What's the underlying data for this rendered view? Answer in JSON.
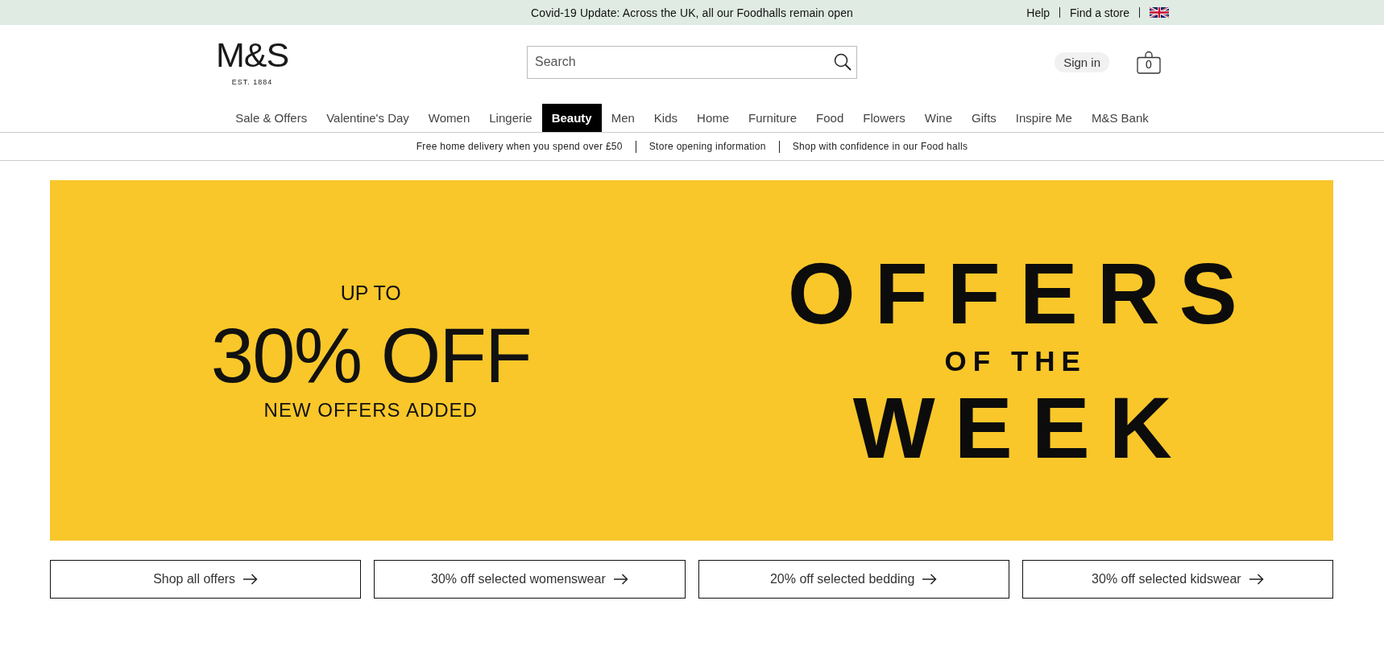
{
  "announcement_bar": {
    "message": "Covid-19 Update: Across the UK, all our Foodhalls remain open",
    "links": [
      "Help",
      "Find a store"
    ]
  },
  "header": {
    "logo": {
      "wordmark": "M&S",
      "tagline": "EST. 1884"
    },
    "search": {
      "placeholder": "Search"
    },
    "sign_in": "Sign in",
    "basket_count": "0"
  },
  "nav": [
    {
      "label": "Sale & Offers",
      "selected": false
    },
    {
      "label": "Valentine's Day",
      "selected": false
    },
    {
      "label": "Women",
      "selected": false
    },
    {
      "label": "Lingerie",
      "selected": false
    },
    {
      "label": "Beauty",
      "selected": true
    },
    {
      "label": "Men",
      "selected": false
    },
    {
      "label": "Kids",
      "selected": false
    },
    {
      "label": "Home",
      "selected": false
    },
    {
      "label": "Furniture",
      "selected": false
    },
    {
      "label": "Food",
      "selected": false
    },
    {
      "label": "Flowers",
      "selected": false
    },
    {
      "label": "Wine",
      "selected": false
    },
    {
      "label": "Gifts",
      "selected": false
    },
    {
      "label": "Inspire Me",
      "selected": false
    },
    {
      "label": "M&S Bank",
      "selected": false
    }
  ],
  "info_strip": [
    "Free home delivery when you spend over £50",
    "Store opening information",
    "Shop with confidence in our Food halls"
  ],
  "banner": {
    "kicker": "UP TO",
    "headline": "30% OFF",
    "subline": "NEW OFFERS ADDED",
    "title": [
      {
        "text": "OFFERS",
        "kind": "large"
      },
      {
        "text": "OF THE",
        "kind": "small"
      },
      {
        "text": "WEEK",
        "kind": "large"
      }
    ]
  },
  "offer_links": [
    "Shop all offers",
    "30% off selected womenswear",
    "20% off selected bedding",
    "30% off selected kidswear"
  ]
}
